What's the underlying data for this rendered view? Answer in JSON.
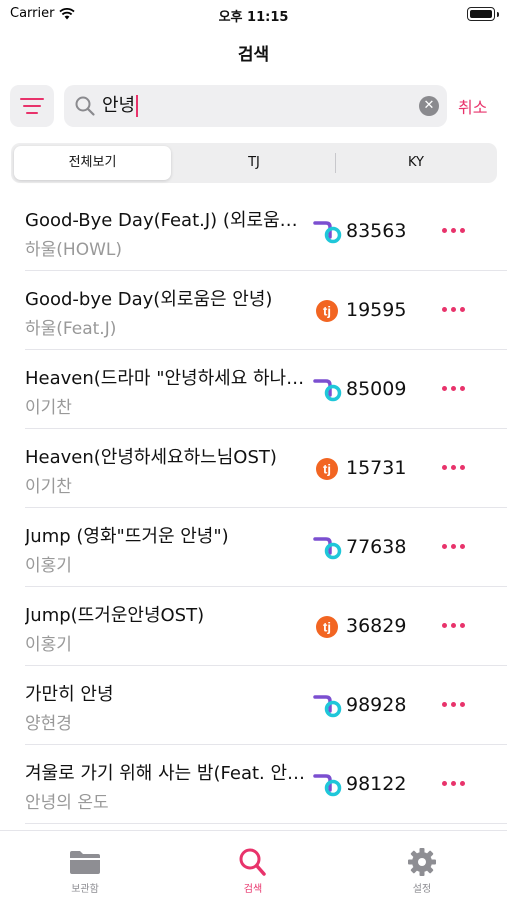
{
  "status_bar": {
    "carrier": "Carrier",
    "time": "오후 11:15"
  },
  "nav": {
    "title": "검색"
  },
  "search": {
    "value": "안녕",
    "cancel_label": "취소"
  },
  "segments": [
    "전체보기",
    "TJ",
    "KY"
  ],
  "songs": [
    {
      "title": "Good-Bye Day(Feat.J) (외로움은 안녕)",
      "artist": "하울(HOWL)",
      "brand": "KY",
      "number": "83563"
    },
    {
      "title": "Good-bye Day(외로움은 안녕)",
      "artist": "하울(Feat.J)",
      "brand": "TJ",
      "number": "19595"
    },
    {
      "title": "Heaven(드라마 \"안녕하세요 하나님\" OST)",
      "artist": "이기찬",
      "brand": "KY",
      "number": "85009"
    },
    {
      "title": "Heaven(안녕하세요하느님OST)",
      "artist": "이기찬",
      "brand": "TJ",
      "number": "15731"
    },
    {
      "title": "Jump (영화\"뜨거운 안녕\")",
      "artist": "이홍기",
      "brand": "KY",
      "number": "77638"
    },
    {
      "title": "Jump(뜨거운안녕OST)",
      "artist": "이홍기",
      "brand": "TJ",
      "number": "36829"
    },
    {
      "title": "가만히 안녕",
      "artist": "양현경",
      "brand": "KY",
      "number": "98928"
    },
    {
      "title": "겨울로 가기 위해 사는 밤(Feat. 안녕의 온도)",
      "artist": "안녕의 온도",
      "brand": "KY",
      "number": "98122"
    }
  ],
  "tabs": [
    {
      "label": "보관함",
      "icon": "folder-icon"
    },
    {
      "label": "검색",
      "icon": "search-icon"
    },
    {
      "label": "설정",
      "icon": "gear-icon"
    }
  ],
  "colors": {
    "accent": "#e8336b",
    "tj_orange": "#f26522",
    "ky_purple": "#7b4fd0",
    "ky_cyan": "#1fc7d9"
  }
}
